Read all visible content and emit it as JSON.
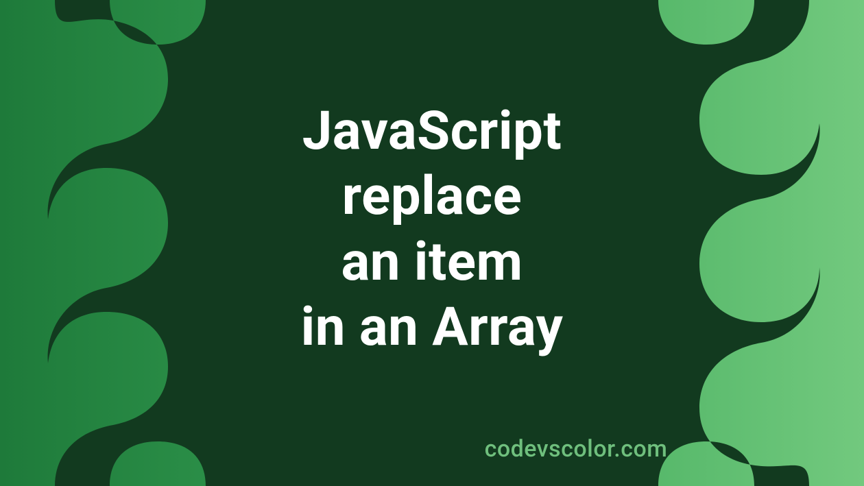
{
  "title_lines": [
    "JavaScript",
    "replace",
    "an item",
    "in an Array"
  ],
  "credit": "codevscolor.com",
  "colors": {
    "blob": "#123a1f",
    "text": "#ffffff",
    "credit": "#6fbf7d",
    "gradient_start": "#1e7a3a",
    "gradient_end": "#72c97e"
  }
}
